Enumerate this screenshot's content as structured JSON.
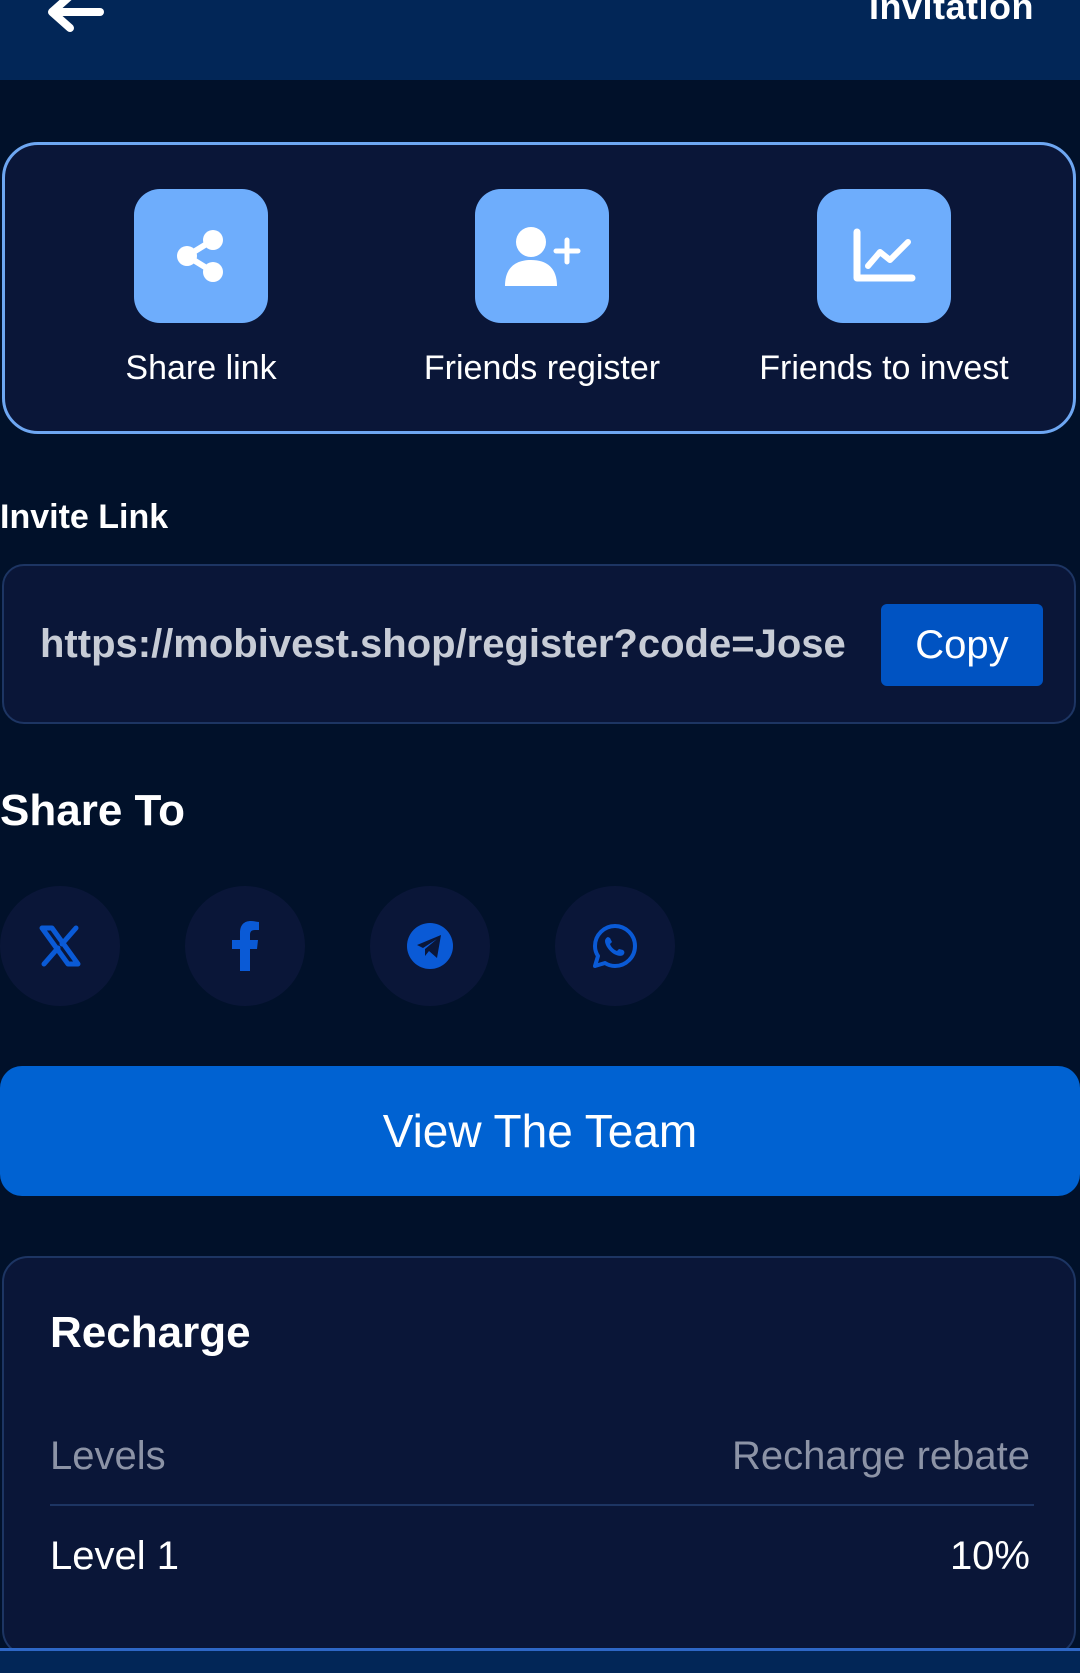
{
  "header": {
    "title": "Invitation",
    "back_icon": "arrow-left-icon"
  },
  "actions": [
    {
      "label": "Share link",
      "icon": "share-icon"
    },
    {
      "label": "Friends register",
      "icon": "user-plus-icon"
    },
    {
      "label": "Friends to invest",
      "icon": "chart-line-icon"
    }
  ],
  "invite": {
    "label": "Invite Link",
    "url": "https://mobivest.shop/register?code=Jose",
    "copy_label": "Copy"
  },
  "share": {
    "label": "Share To",
    "targets": [
      "x-icon",
      "facebook-icon",
      "telegram-icon",
      "whatsapp-icon"
    ]
  },
  "team_button": "View The Team",
  "recharge": {
    "title": "Recharge",
    "columns": [
      "Levels",
      "Recharge rebate"
    ],
    "rows": [
      {
        "level": "Level 1",
        "rebate": "10%"
      }
    ]
  },
  "colors": {
    "background": "#01112a",
    "header": "#022657",
    "card": "#0a1638",
    "accent": "#0062d2",
    "icon_tile": "#6eadfc"
  }
}
